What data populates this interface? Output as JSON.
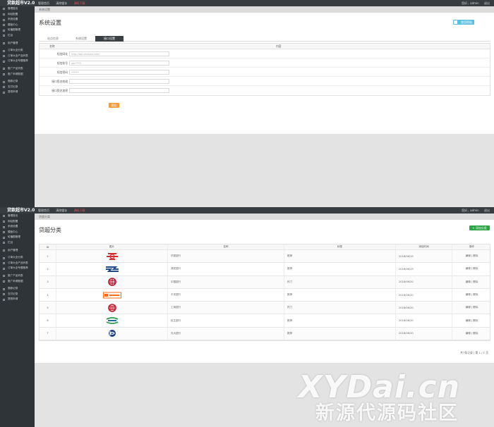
{
  "topbar": {
    "logo": "贷款超市V2.0",
    "nav": [
      "管理首页",
      "清除缓存",
      "源码下载"
    ],
    "right": [
      "您好，admin",
      "退出"
    ]
  },
  "sidebar": {
    "items": [
      "管理首页",
      "网站配置",
      "系统设置",
      "模板中心",
      "轮播图管理",
      "栏目",
      "用户管理",
      "订单大全分类",
      "订单大全产品列表",
      "订单大全专题推荐",
      "推广产品列表",
      "推广申请数据",
      "借款记录",
      "支付记录",
      "提现申请"
    ]
  },
  "settings_page": {
    "breadcrumb": "系统设置",
    "title": "系统设置",
    "help_label": "使用帮助",
    "tabs": [
      "站点信息",
      "系统设置",
      "接口设置"
    ],
    "table_headers": [
      "名称",
      "内容"
    ],
    "fields": [
      {
        "label": "短信网址",
        "value": "http://api.smsbao.com/"
      },
      {
        "label": "短信账号",
        "value": "abc***0"
      },
      {
        "label": "短信密码",
        "value": "******"
      },
      {
        "label": "接口签名前缀",
        "value": ""
      },
      {
        "label": "接口签名加密",
        "value": ""
      }
    ],
    "save_label": "保存"
  },
  "category_page": {
    "breadcrumb": "贷超分类",
    "title": "贷超分类",
    "add_label": "添加分类",
    "headers": [
      "ID",
      "图片",
      "名称",
      "标签",
      "添加时间",
      "操作"
    ],
    "rows": [
      {
        "id": "1",
        "name": "华夏银行",
        "tag": "推荐",
        "time": "2018/06/19",
        "op": "编辑 | 删除",
        "logo": "hxb",
        "color": "#d42a2a"
      },
      {
        "id": "2",
        "name": "浦发银行",
        "tag": "推荐",
        "time": "2018/06/19",
        "op": "编辑 | 删除",
        "logo": "spdb",
        "color": "#1e4a8c"
      },
      {
        "id": "3",
        "name": "中国银行",
        "tag": "热门",
        "time": "2018/06/20",
        "op": "编辑 | 删除",
        "logo": "boc",
        "color": "#b5122a"
      },
      {
        "id": "4",
        "name": "平安银行",
        "tag": "推荐",
        "time": "2018/06/20",
        "op": "编辑 | 删除",
        "logo": "pab",
        "color": "#ff6a13"
      },
      {
        "id": "5",
        "name": "工商银行",
        "tag": "热门",
        "time": "2018/06/20",
        "op": "编辑 | 删除",
        "logo": "icbc",
        "color": "#c7162b"
      },
      {
        "id": "6",
        "name": "民生银行",
        "tag": "推荐",
        "time": "2018/06/20",
        "op": "编辑 | 删除",
        "logo": "cmbc",
        "color": "#1c6b9e"
      },
      {
        "id": "7",
        "name": "光大银行",
        "tag": "推荐",
        "time": "2018/06/20",
        "op": "编辑 | 删除",
        "logo": "ceb",
        "color": "#1d3f8a"
      }
    ],
    "pager": "共7条记录 | 第 1 / 1 页"
  },
  "watermark": {
    "line1": "XYDai.cn",
    "line2": "新源代源码社区"
  }
}
